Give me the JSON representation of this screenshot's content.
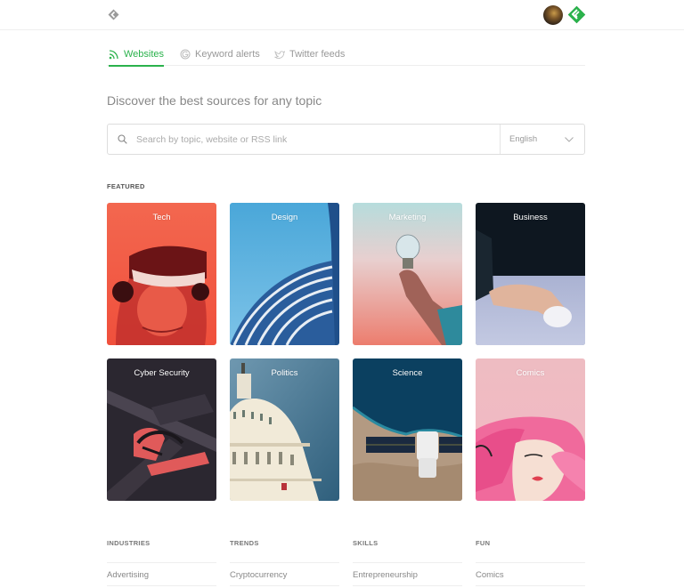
{
  "header": {
    "logo_icon": "feedly-logo-icon",
    "avatar_icon": "user-avatar",
    "app_badge_icon": "feedly-badge-icon"
  },
  "tabs": [
    {
      "label": "Websites",
      "icon": "rss-icon",
      "active": true
    },
    {
      "label": "Keyword alerts",
      "icon": "google-icon",
      "active": false
    },
    {
      "label": "Twitter feeds",
      "icon": "twitter-icon",
      "active": false
    }
  ],
  "headline": "Discover the best sources for any topic",
  "search": {
    "placeholder": "Search by topic, website or RSS link",
    "value": "",
    "language": "English"
  },
  "featured": {
    "label": "FEATURED",
    "cards": [
      {
        "label": "Tech"
      },
      {
        "label": "Design"
      },
      {
        "label": "Marketing"
      },
      {
        "label": "Business"
      },
      {
        "label": "Cyber Security"
      },
      {
        "label": "Politics"
      },
      {
        "label": "Science"
      },
      {
        "label": "Comics"
      }
    ]
  },
  "categories": [
    {
      "title": "INDUSTRIES",
      "items": [
        "Advertising"
      ]
    },
    {
      "title": "TRENDS",
      "items": [
        "Cryptocurrency"
      ]
    },
    {
      "title": "SKILLS",
      "items": [
        "Entrepreneurship"
      ]
    },
    {
      "title": "FUN",
      "items": [
        "Comics"
      ]
    }
  ],
  "colors": {
    "accent": "#2bb24c"
  }
}
